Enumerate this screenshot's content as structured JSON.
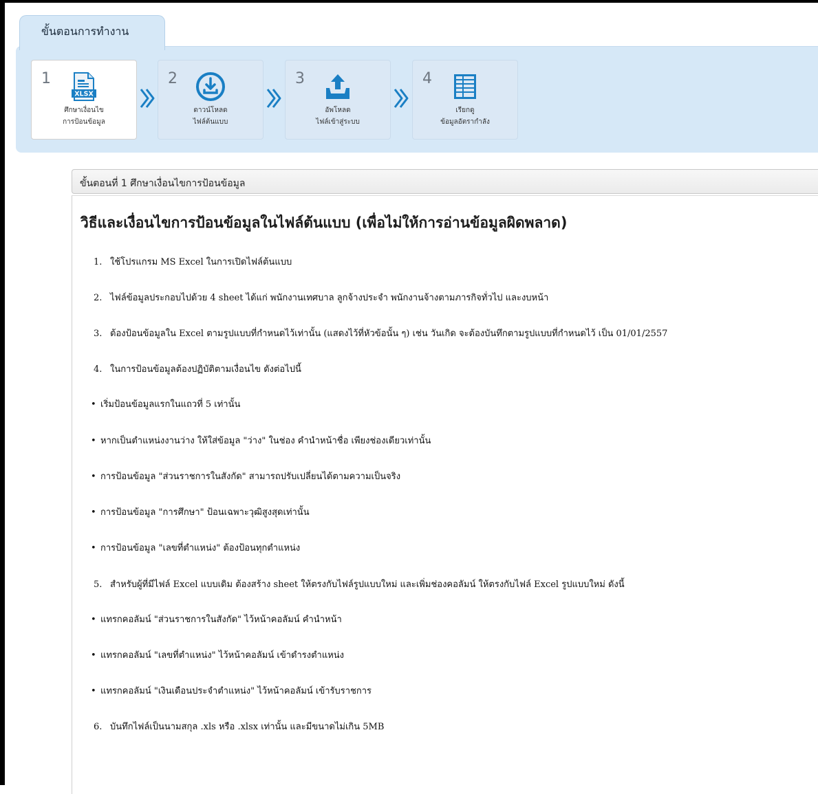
{
  "workflow": {
    "tab_label": "ขั้นตอนการทำงาน",
    "steps": [
      {
        "num": "1",
        "icon": "xlsx-file-icon",
        "line1": "ศึกษาเงื่อนไข",
        "line2": "การป้อนข้อมูล",
        "active": true
      },
      {
        "num": "2",
        "icon": "download-icon",
        "line1": "ดาวน์โหลด",
        "line2": "ไฟล์ต้นแบบ",
        "active": false
      },
      {
        "num": "3",
        "icon": "upload-tray-icon",
        "line1": "อัพโหลด",
        "line2": "ไฟล์เข้าสู่ระบบ",
        "active": false
      },
      {
        "num": "4",
        "icon": "table-grid-icon",
        "line1": "เรียกดู",
        "line2": "ข้อมูลอัตรากำลัง",
        "active": false
      }
    ],
    "accent_color": "#1a7fc4",
    "panel_color": "#d6e8f7"
  },
  "section": {
    "header": "ขั้นตอนที่ 1 ศึกษาเงื่อนไขการป้อนข้อมูล",
    "title": "วิธีและเงื่อนไขการป้อนข้อมูลในไฟล์ต้นแบบ (เพื่อไม่ให้การอ่านข้อมูลผิดพลาด)",
    "items": [
      {
        "marker": "1.",
        "text": "ใช้โปรแกรม MS Excel ในการเปิดไฟล์ต้นแบบ"
      },
      {
        "marker": "2.",
        "text": "ไฟล์ข้อมูลประกอบไปด้วย 4 sheet ได้แก่ พนักงานเทศบาล ลูกจ้างประจำ พนักงานจ้างตามภารกิจทั่วไป และงบหน้า"
      },
      {
        "marker": "3.",
        "text": "ต้องป้อนข้อมูลใน Excel ตามรูปแบบที่กำหนดไว้เท่านั้น (แสดงไว้ที่หัวข้อนั้น ๆ) เช่น วันเกิด จะต้องบันทึกตามรูปแบบที่กำหนดไว้ เป็น 01/01/2557"
      },
      {
        "marker": "4.",
        "text": "ในการป้อนข้อมูลต้องปฏิบัติตามเงื่อนไข ดังต่อไปนี้"
      },
      {
        "marker": "•",
        "text": "เริ่มป้อนข้อมูลแรกในแถวที่ 5 เท่านั้น"
      },
      {
        "marker": "•",
        "text": "หากเป็นตำแหน่งงานว่าง ให้ใส่ข้อมูล \"ว่าง\" ในช่อง คำนำหน้าชื่อ เพียงช่องเดียวเท่านั้น"
      },
      {
        "marker": "•",
        "text": "การป้อนข้อมูล \"ส่วนราชการในสังกัด\" สามารถปรับเปลี่ยนได้ตามความเป็นจริง"
      },
      {
        "marker": "•",
        "text": "การป้อนข้อมูล \"การศึกษา\" ป้อนเฉพาะวุฒิสูงสุดเท่านั้น"
      },
      {
        "marker": "•",
        "text": "การป้อนข้อมูล \"เลขที่ตำแหน่ง\" ต้องป้อนทุกตำแหน่ง"
      },
      {
        "marker": "5.",
        "text": "สำหรับผู้ที่มีไฟล์ Excel แบบเดิม ต้องสร้าง sheet ให้ตรงกับไฟล์รูปแบบใหม่ และเพิ่มช่องคอลัมน์ ให้ตรงกับไฟล์ Excel รูปแบบใหม่ ดังนี้"
      },
      {
        "marker": "•",
        "text": "แทรกคอลัมน์ \"ส่วนราชการในสังกัด\" ไว้หน้าคอลัมน์ คำนำหน้า"
      },
      {
        "marker": "•",
        "text": "แทรกคอลัมน์ \"เลขที่ตำแหน่ง\" ไว้หน้าคอลัมน์ เข้าดำรงตำแหน่ง"
      },
      {
        "marker": "•",
        "text": "แทรกคอลัมน์ \"เงินเดือนประจำตำแหน่ง\" ไว้หน้าคอลัมน์ เข้ารับราชการ"
      },
      {
        "marker": "6.",
        "text": "บันทึกไฟล์เป็นนามสกุล .xls หรือ .xlsx เท่านั้น และมีขนาดไม่เกิน 5MB"
      }
    ]
  }
}
